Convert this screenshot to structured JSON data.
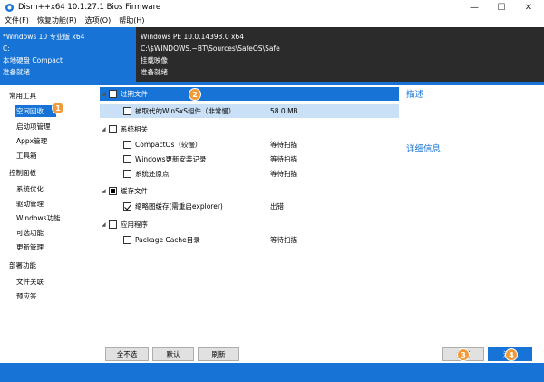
{
  "window": {
    "title": "Dism++x64 10.1.27.1 Bios Firmware",
    "controls": {
      "minimize": "—",
      "maximize": "☐",
      "close": "✕"
    }
  },
  "menu": [
    "文件(F)",
    "恢复功能(R)",
    "选项(O)",
    "帮助(H)"
  ],
  "info_left": [
    "*Windows 10 专业版 x64",
    "C:",
    "本地硬盘 Compact",
    "准备就绪"
  ],
  "info_right": [
    "Windows PE 10.0.14393.0 x64",
    "C:\\$WINDOWS.~BT\\Sources\\SafeOS\\Safe",
    "挂载映像",
    "准备就绪"
  ],
  "sidebar": {
    "groups": [
      {
        "label": "常用工具",
        "items": [
          "空间回收",
          "启动项管理",
          "Appx管理",
          "工具箱"
        ]
      },
      {
        "label": "控制面板",
        "items": [
          "系统优化",
          "驱动管理",
          "Windows功能",
          "可选功能",
          "更新管理"
        ]
      },
      {
        "label": "部署功能",
        "items": [
          "文件关联",
          "预应答"
        ]
      }
    ]
  },
  "tree": [
    {
      "label": "过期文件",
      "type": "category",
      "state": "unchecked",
      "selected": true
    },
    {
      "label": "被取代的WinSxS组件（非常慢）",
      "type": "child",
      "state": "unchecked",
      "status": "58.0 MB",
      "selected": true
    },
    {
      "label": "系统相关",
      "type": "category",
      "state": "unchecked"
    },
    {
      "label": "CompactOs（较慢）",
      "type": "child",
      "state": "unchecked",
      "status": "等待扫描"
    },
    {
      "label": "Windows更新安装记录",
      "type": "child",
      "state": "unchecked",
      "status": "等待扫描"
    },
    {
      "label": "系统还原点",
      "type": "child",
      "state": "unchecked",
      "status": "等待扫描"
    },
    {
      "label": "缓存文件",
      "type": "category",
      "state": "partial"
    },
    {
      "label": "缩略图缓存(需重启explorer)",
      "type": "child",
      "state": "checked",
      "status": "出错"
    },
    {
      "label": "应用程序",
      "type": "category",
      "state": "unchecked"
    },
    {
      "label": "Package Cache目录",
      "type": "child",
      "state": "unchecked",
      "status": "等待扫描"
    }
  ],
  "right_panel": {
    "description": "描述",
    "details": "详细信息"
  },
  "buttons": {
    "select_none": "全不选",
    "default": "默认",
    "refresh": "刷新",
    "scan": "扫描",
    "clean": "清理"
  },
  "markers": [
    "1",
    "2",
    "3",
    "4"
  ],
  "colors": {
    "accent": "#1773d5",
    "dark_panel": "#2b2b2b",
    "marker": "#f29a38"
  },
  "icons": {
    "app": "dism-app-icon",
    "caret": "expand-caret-icon"
  }
}
